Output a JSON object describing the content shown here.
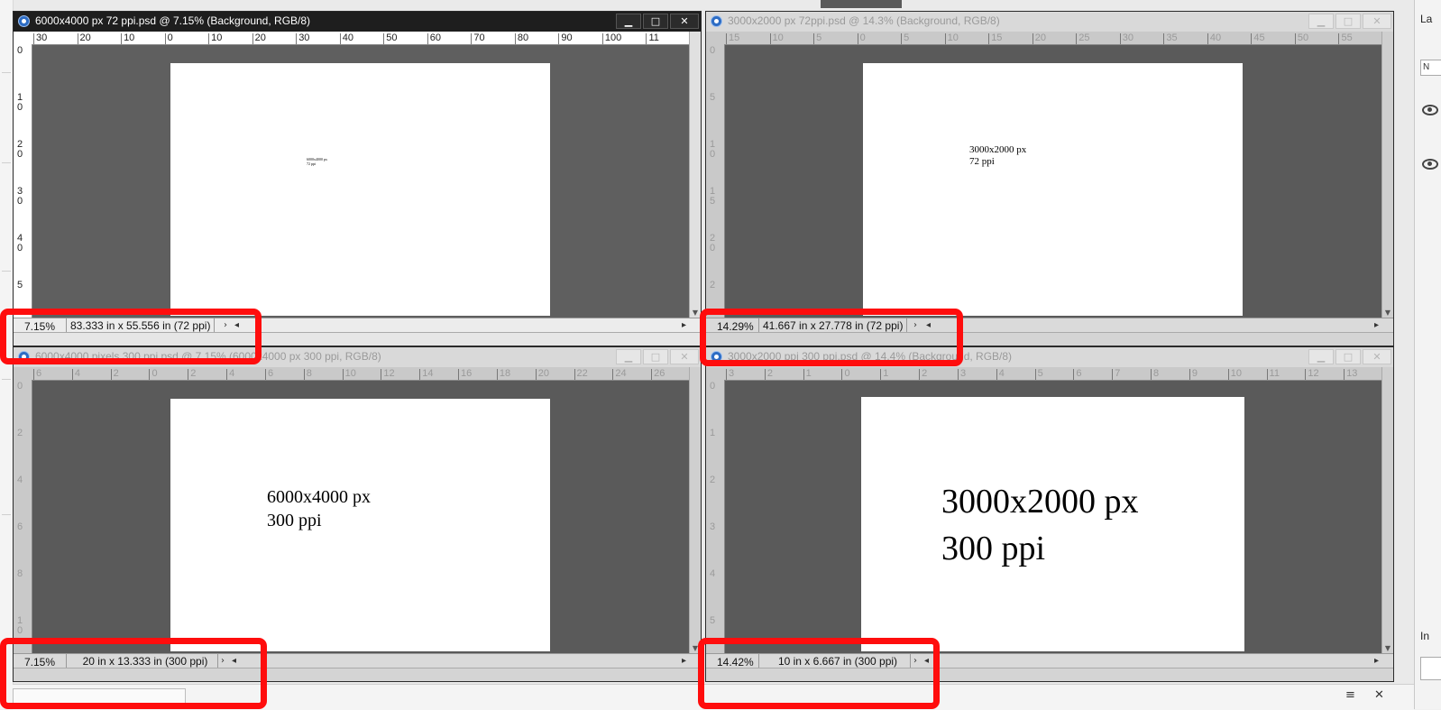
{
  "windows": [
    {
      "title": "6000x4000 px 72 ppi.psd @ 7.15% (Background, RGB/8)",
      "zoom": "7.15%",
      "doc_size": "83.333 in x 55.556 in (72 ppi)",
      "ruler_h": [
        "30",
        "20",
        "10",
        "0",
        "10",
        "20",
        "30",
        "40",
        "50",
        "60",
        "70",
        "80",
        "90",
        "100",
        "11"
      ],
      "ruler_v": [
        "0",
        "10",
        "20",
        "30",
        "40",
        "5"
      ],
      "page_text": [
        "6000x4000 px",
        "72 ppi"
      ],
      "active": true
    },
    {
      "title": "3000x2000 px 72ppi.psd @ 14.3% (Background, RGB/8)",
      "zoom": "14.29%",
      "doc_size": "41.667 in x 27.778 in (72 ppi)",
      "ruler_h": [
        "15",
        "10",
        "5",
        "0",
        "5",
        "10",
        "15",
        "20",
        "25",
        "30",
        "35",
        "40",
        "45",
        "50",
        "55"
      ],
      "ruler_v": [
        "0",
        "5",
        "10",
        "15",
        "20",
        "2"
      ],
      "page_text": [
        "3000x2000 px",
        "72 ppi"
      ],
      "active": false
    },
    {
      "title": "6000x4000 pixels 300 ppi.psd @ 7.15% (6000x4000 px 300 ppi, RGB/8)",
      "zoom": "7.15%",
      "doc_size": "20 in x 13.333 in (300 ppi)",
      "ruler_h": [
        "6",
        "4",
        "2",
        "0",
        "2",
        "4",
        "6",
        "8",
        "10",
        "12",
        "14",
        "16",
        "18",
        "20",
        "22",
        "24",
        "26"
      ],
      "ruler_v": [
        "0",
        "2",
        "4",
        "6",
        "8",
        "10",
        "12"
      ],
      "page_text": [
        "6000x4000 px",
        "300 ppi"
      ],
      "active": false
    },
    {
      "title": "3000x2000 ppi 300 ppi.psd @ 14.4% (Background, RGB/8)",
      "zoom": "14.42%",
      "doc_size": "10 in x 6.667 in (300 ppi)",
      "ruler_h": [
        "3",
        "2",
        "1",
        "0",
        "1",
        "2",
        "3",
        "4",
        "5",
        "6",
        "7",
        "8",
        "9",
        "10",
        "11",
        "12",
        "13"
      ],
      "ruler_v": [
        "0",
        "1",
        "2",
        "3",
        "4",
        "5",
        "6"
      ],
      "page_text": [
        "3000x2000 px",
        "300 ppi"
      ],
      "active": false
    }
  ],
  "window_buttons": {
    "minimize": "▁",
    "maximize": "□",
    "close": "✕"
  },
  "right_panel": {
    "layers_label": "La",
    "mode_box": "N",
    "info_label": "In"
  },
  "colors": {
    "highlight": "#ff0d0d",
    "canvas_bg": "#5f5f5f",
    "titlebar_active": "#1e1e1e"
  }
}
